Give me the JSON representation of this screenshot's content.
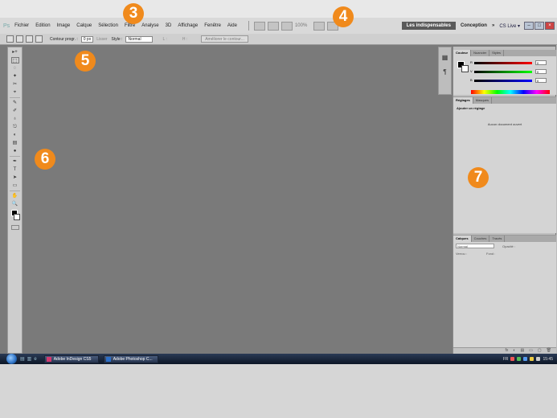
{
  "app": {
    "logo": "Ps"
  },
  "menu": {
    "items": [
      "Fichier",
      "Edition",
      "Image",
      "Calque",
      "Sélection",
      "Filtre",
      "Analyse",
      "3D",
      "Affichage",
      "Fenêtre",
      "Aide"
    ],
    "zoom": "100%",
    "workspaces": {
      "active": "Les indispensables",
      "other": "Conception",
      "more": "»"
    },
    "cslive": "CS Live ▾"
  },
  "options_bar": {
    "contour_label": "Contour progr. :",
    "contour_value": "0 px",
    "lisser_label": "Lisser",
    "style_label": "Style :",
    "style_value": "Normal",
    "largeur_label": "L :",
    "hauteur_label": "H :",
    "ameliorer_button": "Améliorer le contour..."
  },
  "tools": [
    "▸+",
    "⬚",
    "◌",
    "✦",
    "✂",
    "⌖",
    "✎",
    "✐",
    "♁",
    "⎋",
    "◐",
    "▤",
    "●",
    "✒",
    "T",
    "➤",
    "▭",
    "✋",
    "🔍"
  ],
  "panels": {
    "color_tabs": [
      "Couleur",
      "Nuancier",
      "Styles"
    ],
    "sliders": [
      {
        "label": "R",
        "value": "0",
        "gradient": "linear-gradient(to right, #000, #f00)"
      },
      {
        "label": "V",
        "value": "0",
        "gradient": "linear-gradient(to right, #000, #0f0)"
      },
      {
        "label": "B",
        "value": "0",
        "gradient": "linear-gradient(to right, #000, #00f)"
      }
    ],
    "adjust_tabs": [
      "Réglages",
      "Masques"
    ],
    "adjust_title": "Ajouter un réglage",
    "adjust_message": "Aucun document ouvert",
    "layers_tabs": [
      "Calques",
      "Couches",
      "Tracés"
    ],
    "layers_mode": "Normal",
    "layers_opacity_label": "Opacité :",
    "layers_lock_label": "Verrou :",
    "layers_fill_label": "Fond :",
    "footer_icons": [
      "fx",
      "◐",
      "▤",
      "▭",
      "▢",
      "🗑"
    ]
  },
  "taskbar": {
    "apps": [
      {
        "label": "Adobe InDesign CS5",
        "color": "#d0396f"
      },
      {
        "label": "Adobe Photoshop C...",
        "color": "#2c6fc8"
      }
    ],
    "lang": "FR",
    "clock": "15:45"
  },
  "callouts": [
    "3",
    "4",
    "5",
    "6",
    "7"
  ],
  "colors": {
    "accent": "#f08a1c",
    "workspace_bg": "#7a7a7a",
    "panel_bg": "#d4d4d4"
  }
}
